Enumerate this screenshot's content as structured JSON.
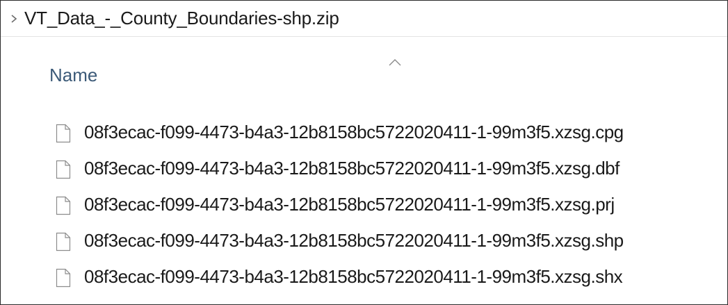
{
  "breadcrumb": {
    "chevron_icon": "chevron-right-icon",
    "path": "VT_Data_-_County_Boundaries-shp.zip"
  },
  "columns": {
    "name_label": "Name",
    "sort_icon": "sort-ascending-icon"
  },
  "files": [
    {
      "name": "08f3ecac-f099-4473-b4a3-12b8158bc5722020411-1-99m3f5.xzsg.cpg",
      "icon": "file-icon"
    },
    {
      "name": "08f3ecac-f099-4473-b4a3-12b8158bc5722020411-1-99m3f5.xzsg.dbf",
      "icon": "file-icon"
    },
    {
      "name": "08f3ecac-f099-4473-b4a3-12b8158bc5722020411-1-99m3f5.xzsg.prj",
      "icon": "file-icon"
    },
    {
      "name": "08f3ecac-f099-4473-b4a3-12b8158bc5722020411-1-99m3f5.xzsg.shp",
      "icon": "file-icon"
    },
    {
      "name": "08f3ecac-f099-4473-b4a3-12b8158bc5722020411-1-99m3f5.xzsg.shx",
      "icon": "file-icon"
    }
  ]
}
